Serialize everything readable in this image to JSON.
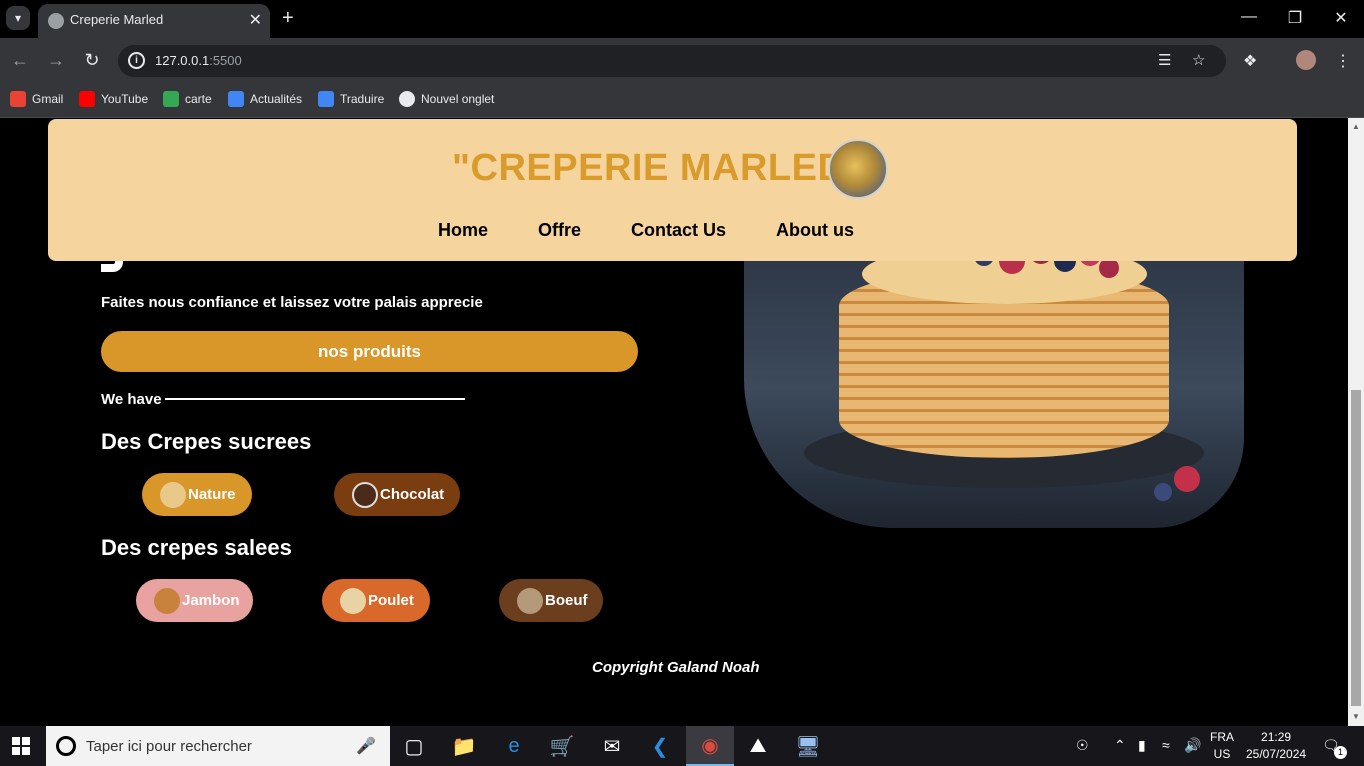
{
  "browser": {
    "tab_title": "Creperie Marled",
    "url_host": "127.0.0.1",
    "url_port": ":5500",
    "bookmarks": [
      {
        "label": "Gmail",
        "icon": "gmail-icon",
        "color": "#ea4335"
      },
      {
        "label": "YouTube",
        "icon": "youtube-icon",
        "color": "#ff0000"
      },
      {
        "label": "carte",
        "icon": "maps-icon",
        "color": "#34a853"
      },
      {
        "label": "Actualités",
        "icon": "news-icon",
        "color": "#4285f4"
      },
      {
        "label": "Traduire",
        "icon": "translate-icon",
        "color": "#4285f4"
      },
      {
        "label": "Nouvel onglet",
        "icon": "globe-icon",
        "color": "#e8eaed"
      }
    ]
  },
  "page": {
    "site_title": "\"CREPERIE MARLED\"",
    "nav": [
      "Home",
      "Offre",
      "Contact Us",
      "About us"
    ],
    "tagline": "Faites nous confiance et laissez votre palais apprecie",
    "cta_label": "nos produits",
    "we_have": "We have",
    "sweet_title": "Des Crepes sucrees",
    "sweet_items": [
      {
        "label": "Nature",
        "color": "#d9972a"
      },
      {
        "label": "Chocolat",
        "color": "#7a3d10"
      }
    ],
    "savory_title": "Des crepes salees",
    "savory_items": [
      {
        "label": "Jambon",
        "color": "#e8a3a0"
      },
      {
        "label": "Poulet",
        "color": "#d8692a"
      },
      {
        "label": "Boeuf",
        "color": "#6b3f1e"
      }
    ],
    "footer": "Copyright Galand Noah"
  },
  "taskbar": {
    "search_placeholder": "Taper ici pour rechercher",
    "lang_top": "FRA",
    "lang_bottom": "US",
    "time": "21:29",
    "date": "25/07/2024",
    "notifications": "1"
  },
  "colors": {
    "header_bg": "#f6d49e",
    "brand_gold": "#d99b2b",
    "page_bg": "#000000"
  }
}
